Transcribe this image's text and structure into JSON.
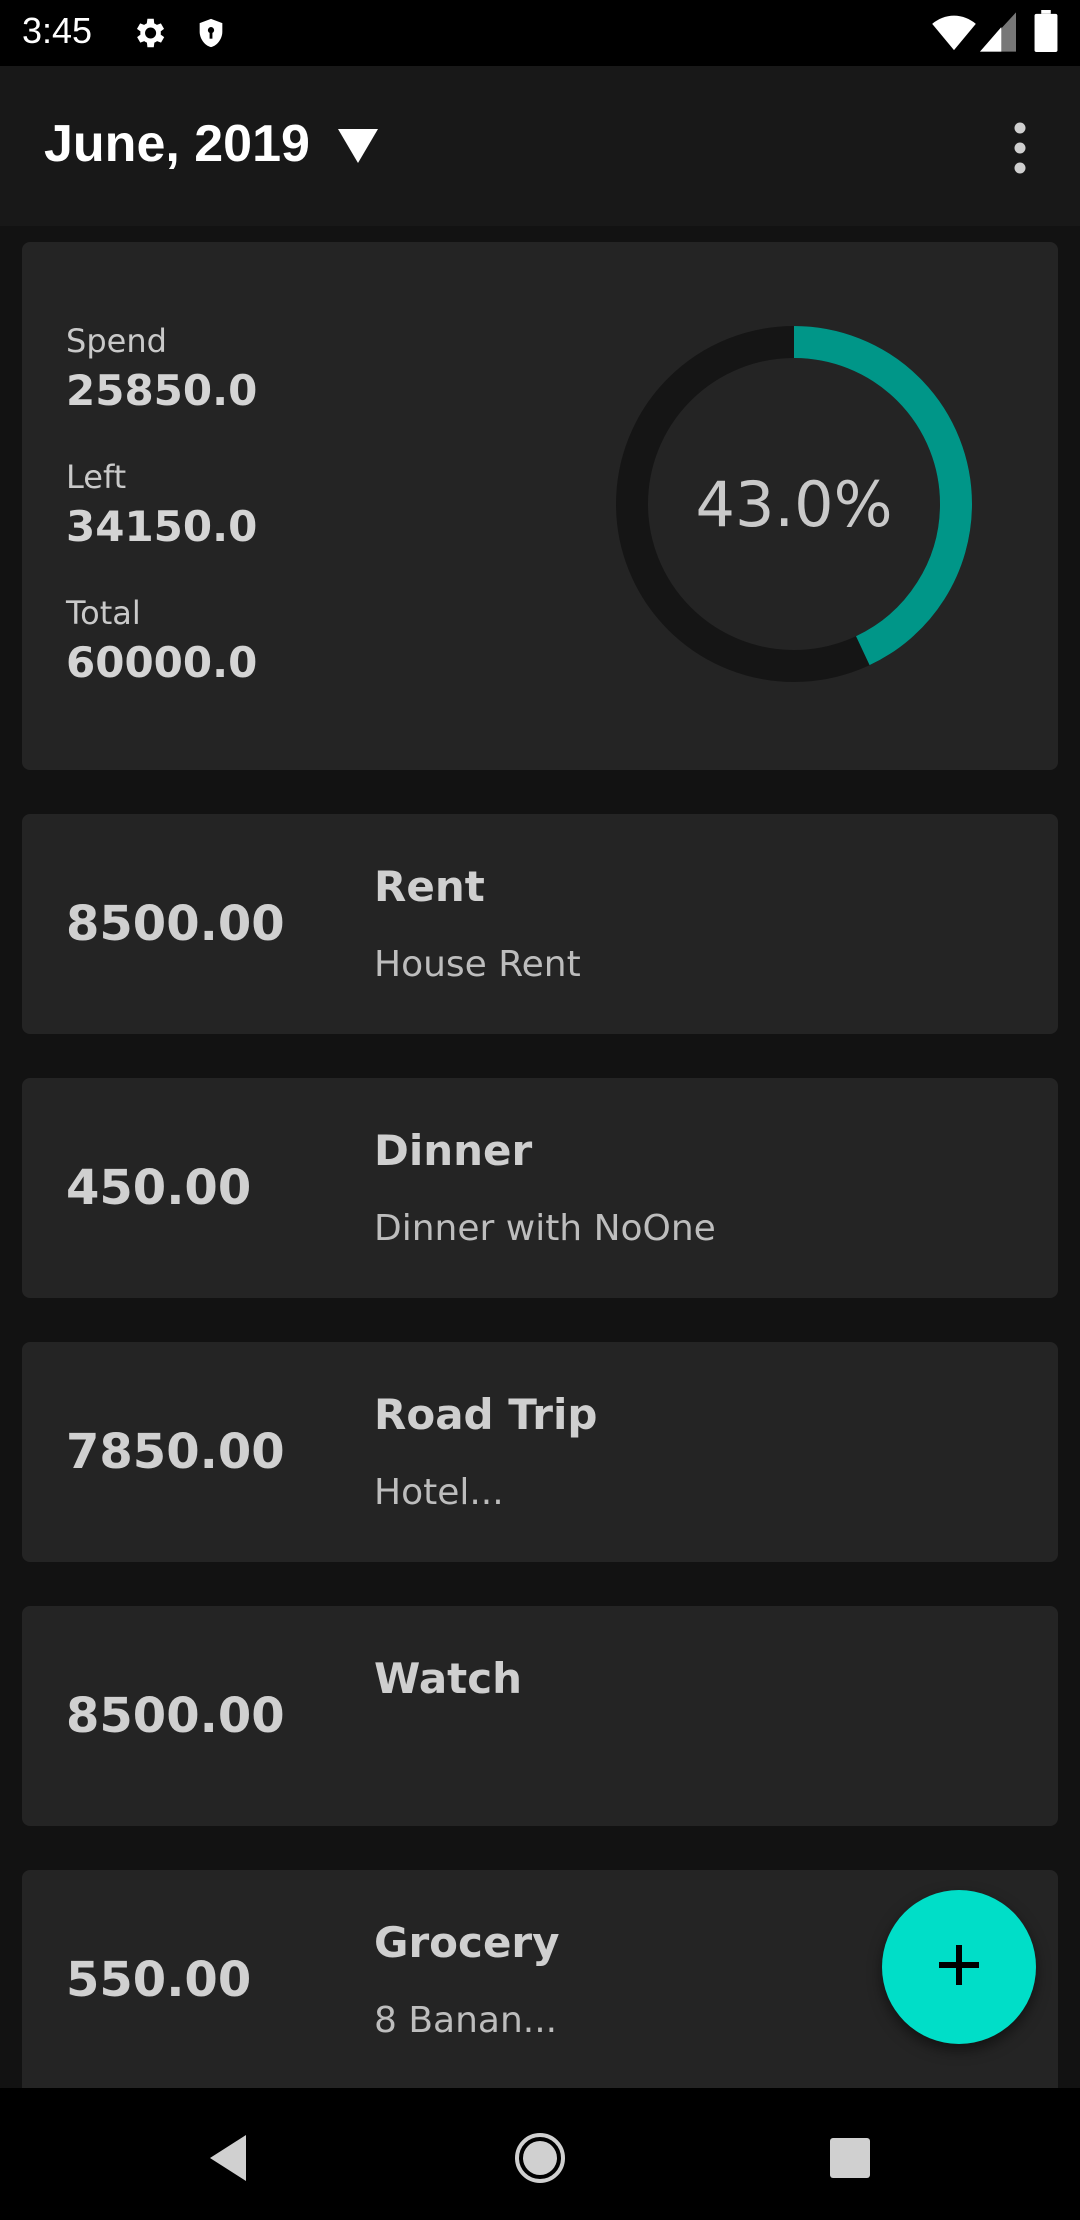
{
  "status_bar": {
    "time": "3:45",
    "icons": [
      "settings-icon",
      "shield-icon",
      "wifi-icon",
      "cellular-icon",
      "battery-icon"
    ]
  },
  "app_bar": {
    "month": "June, 2019",
    "dropdown_icon": "triangle-down-icon",
    "menu_icon": "overflow-menu-icon"
  },
  "summary": {
    "spend_label": "Spend",
    "spend_value": "25850.0",
    "left_label": "Left",
    "left_value": "34150.0",
    "total_label": "Total",
    "total_value": "60000.0",
    "percent_text": "43.0%",
    "percent_fraction": 0.43
  },
  "expenses": [
    {
      "amount": "8500.00",
      "title": "Rent",
      "description": "House Rent"
    },
    {
      "amount": "450.00",
      "title": "Dinner",
      "description": "Dinner with NoOne"
    },
    {
      "amount": "7850.00",
      "title": "Road Trip",
      "description": "Hotel..."
    },
    {
      "amount": "8500.00",
      "title": "Watch",
      "description": ""
    },
    {
      "amount": "550.00",
      "title": "Grocery",
      "description": "8 Banan..."
    }
  ],
  "fab": {
    "icon": "plus-icon"
  },
  "nav_bar": {
    "icons": [
      "back-icon",
      "home-icon",
      "recents-icon"
    ]
  },
  "colors": {
    "accent": "#009688",
    "fab": "#00DEC8",
    "background": "#121212",
    "card": "#242424",
    "ring_track": "#151515"
  }
}
